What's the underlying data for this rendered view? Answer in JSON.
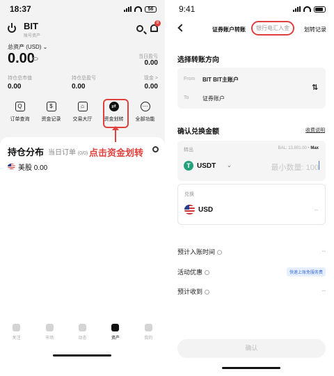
{
  "left": {
    "status_time": "18:37",
    "battery": "56",
    "brand": "BIT",
    "brand_sub": "账号资产",
    "notif_count": "8",
    "total_assets_label": "总资产 (USD) ⌄",
    "total_assets_value": "0.00",
    "today_pnl_label": "当日盈亏",
    "today_pnl_value": "0.00",
    "stats": [
      {
        "label": "持仓总市值",
        "value": "0.00"
      },
      {
        "label": "持仓总盈亏",
        "value": "0.00"
      },
      {
        "label": "现金 >",
        "value": "0.00"
      }
    ],
    "quick_actions": [
      {
        "label": "订单查询",
        "icon": "order-query-icon",
        "glyph": "Q"
      },
      {
        "label": "资金记录",
        "icon": "fund-record-icon",
        "glyph": "$"
      },
      {
        "label": "交易大厅",
        "icon": "trading-hall-icon",
        "glyph": "⌂"
      },
      {
        "label": "资金划转",
        "icon": "fund-transfer-icon",
        "glyph": "⇄"
      },
      {
        "label": "全部功能",
        "icon": "all-functions-icon",
        "glyph": "⋯"
      }
    ],
    "annotation": "点击资金划转",
    "holdings_title": "持仓分布",
    "orders_tab": "当日订单",
    "orders_count": "(0/0)",
    "us_stock": "美股 0.00",
    "tabs": [
      {
        "label": "关注",
        "icon": "watchlist-icon"
      },
      {
        "label": "市场",
        "icon": "market-icon"
      },
      {
        "label": "动态",
        "icon": "feed-icon"
      },
      {
        "label": "资产",
        "icon": "assets-icon"
      },
      {
        "label": "我的",
        "icon": "profile-icon"
      }
    ],
    "active_tab": "资产"
  },
  "right": {
    "status_time": "9:41",
    "tab_securities": "证券账户转账",
    "tab_bank": "银行电汇入金",
    "tab_records": "划转记录",
    "direction_title": "选择转账方向",
    "from_label": "From",
    "from_value": "BIT BIT主账户",
    "to_label": "To",
    "to_value": "证券账户",
    "amount_title": "确认兑换金额",
    "rate_link": "收费说明",
    "out_label": "转出",
    "balance_label": "BAL: 13,801.00 •",
    "max_label": "Max",
    "out_coin": "USDT",
    "amount_placeholder": "最小数量: 100",
    "in_label": "兑换",
    "in_coin": "USD",
    "in_amount": "--",
    "eta_label": "预计入账时间",
    "eta_value": "--",
    "promo_label": "活动优惠",
    "promo_badge": "快速上账免服务费",
    "expected_label": "预计收到",
    "expected_value": "--",
    "confirm_label": "确认"
  },
  "colors": {
    "highlight": "#e0413d",
    "usdt": "#26a17b",
    "badge_text": "#3b6fd0"
  }
}
